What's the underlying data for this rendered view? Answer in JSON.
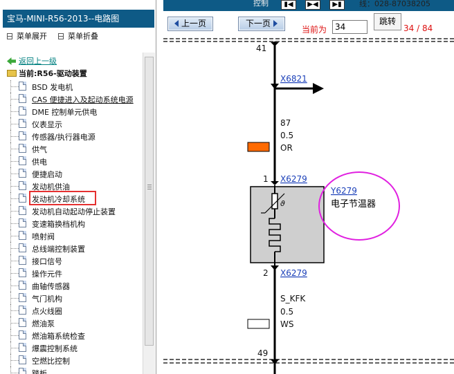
{
  "window": {
    "title": "宝马-MINI-R56-2013--电路图"
  },
  "left_panel": {
    "menu_expand": "菜单展开",
    "menu_collapse": "菜单折叠",
    "back_link": "返回上一级",
    "current_prefix": "当前:",
    "current_node": "R56-驱动装置",
    "items": [
      {
        "label": "BSD 发电机"
      },
      {
        "label": "CAS 便捷进入及起动系统电源"
      },
      {
        "label": "DME 控制单元供电"
      },
      {
        "label": "仪表显示"
      },
      {
        "label": "传感器/执行器电源"
      },
      {
        "label": "供气"
      },
      {
        "label": "供电"
      },
      {
        "label": "便捷启动"
      },
      {
        "label": "发动机供油"
      },
      {
        "label": "发动机冷却系统"
      },
      {
        "label": "发动机自动起动停止装置"
      },
      {
        "label": "变速箱换档机构"
      },
      {
        "label": "喷射阀"
      },
      {
        "label": "总线端控制装置"
      },
      {
        "label": "接口信号"
      },
      {
        "label": "操作元件"
      },
      {
        "label": "曲轴传感器"
      },
      {
        "label": "气门机构"
      },
      {
        "label": "点火线圈"
      },
      {
        "label": "燃油泵"
      },
      {
        "label": "燃油箱系统检查"
      },
      {
        "label": "爆震控制系统"
      },
      {
        "label": "空燃比控制"
      },
      {
        "label": "踏板"
      }
    ],
    "highlighted_index": 9,
    "underlined_index": 1
  },
  "toolbar": {
    "top_text": "控制",
    "contact_text": "线：028-87038205",
    "prev_label": "上一页",
    "next_label": "下一页",
    "current_page_label": "当前为",
    "page_value": "34",
    "jump_label": "跳转",
    "page_count": "34 / 84",
    "accent_color": "#0e5a86"
  },
  "diagram": {
    "top_pin": "41",
    "connector_top": "X6821",
    "wire_top_number": "87",
    "wire_top_size": "0.5",
    "wire_top_color": "OR",
    "wire_top_color_hex": "#ff6a00",
    "pin1": "1",
    "connector_pin1": "X6279",
    "component_id": "Y6279",
    "component_name": "电子节温器",
    "thermo_symbol": "ϑ",
    "pin2": "2",
    "connector_pin2": "X6279",
    "wire_bottom_signal": "S_KFK",
    "wire_bottom_size": "0.5",
    "wire_bottom_color": "WS",
    "wire_bottom_color_hex": "#ffffff",
    "bottom_pin": "49",
    "circle_color": "#e020e0"
  }
}
